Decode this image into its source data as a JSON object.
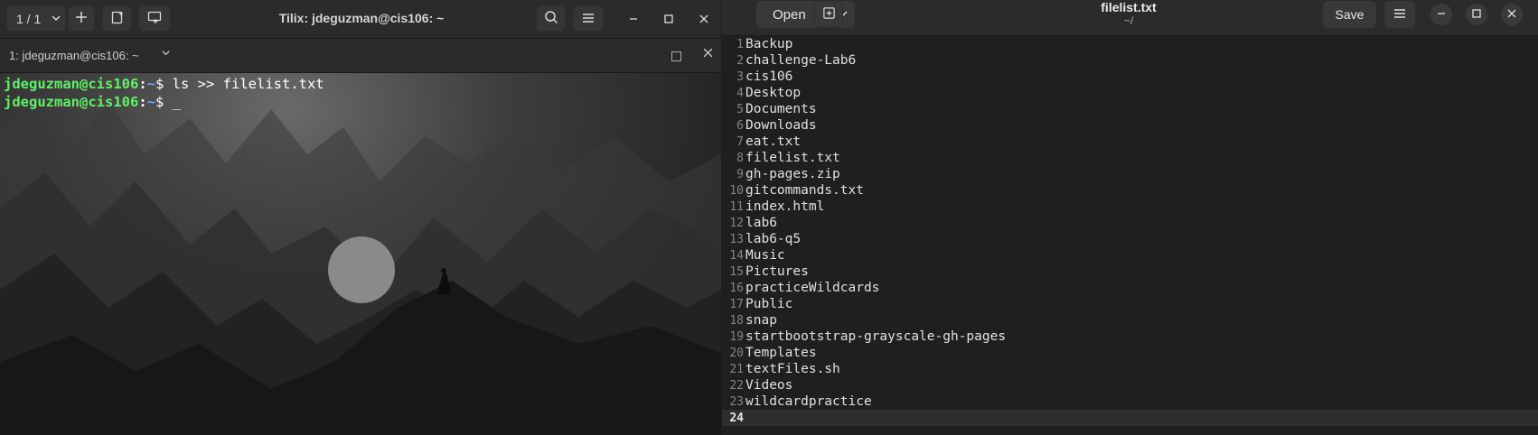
{
  "tilix": {
    "tab_counter": "1 / 1",
    "title": "Tilix: jdeguzman@cis106: ~",
    "session_label": "1: jdeguzman@cis106: ~",
    "terminal": {
      "lines": [
        {
          "user": "jdeguzman@cis106",
          "colon": ":",
          "path": "~",
          "sym": "$ ",
          "cmd": "ls >> filelist.txt"
        },
        {
          "user": "jdeguzman@cis106",
          "colon": ":",
          "path": "~",
          "sym": "$ ",
          "cmd": "_"
        }
      ]
    }
  },
  "gedit": {
    "open_label": "Open",
    "save_label": "Save",
    "title": "filelist.txt",
    "subtitle": "~/",
    "lines": [
      "Backup",
      "challenge-Lab6",
      "cis106",
      "Desktop",
      "Documents",
      "Downloads",
      "eat.txt",
      "filelist.txt",
      "gh-pages.zip",
      "gitcommands.txt",
      "index.html",
      "lab6",
      "lab6-q5",
      "Music",
      "Pictures",
      "practiceWildcards",
      "Public",
      "snap",
      "startbootstrap-grayscale-gh-pages",
      "Templates",
      "textFiles.sh",
      "Videos",
      "wildcardpractice",
      ""
    ],
    "current_line": 24
  }
}
